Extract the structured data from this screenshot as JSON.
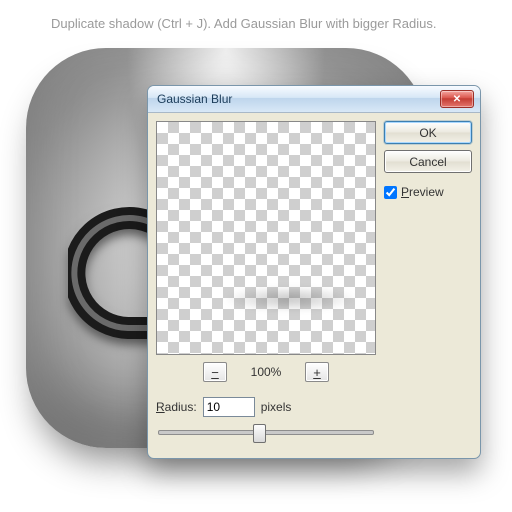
{
  "caption": "Duplicate shadow (Ctrl + J). Add Gaussian Blur with bigger Radius.",
  "dialog": {
    "title": "Gaussian Blur",
    "close_glyph": "✕",
    "ok_label": "OK",
    "cancel_label": "Cancel",
    "preview_label": "Preview",
    "preview_underline": "P",
    "preview_rest": "review",
    "preview_checked": true,
    "zoom": {
      "minus": "−",
      "plus": "+",
      "value": "100%"
    },
    "radius": {
      "label": "Radius:",
      "underline": "R",
      "rest": "adius:",
      "value": "10",
      "unit": "pixels"
    }
  }
}
